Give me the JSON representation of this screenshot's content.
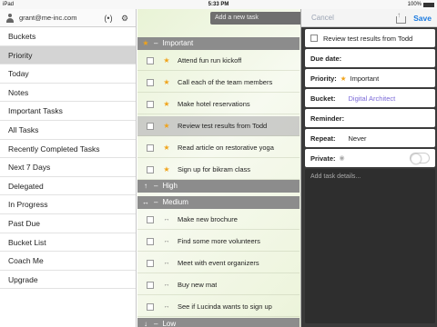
{
  "status_bar": {
    "carrier": "iPad",
    "time": "5:33 PM",
    "battery": "100%"
  },
  "sidebar": {
    "account_email": "grant@me-inc.com",
    "sync_icon": "(•)",
    "settings_icon": "⚙",
    "items": [
      {
        "label": "Buckets",
        "selected": false
      },
      {
        "label": "Priority",
        "selected": true
      },
      {
        "label": "Today",
        "selected": false
      },
      {
        "label": "Notes",
        "selected": false
      },
      {
        "label": "Important Tasks",
        "selected": false
      },
      {
        "label": "All Tasks",
        "selected": false
      },
      {
        "label": "Recently Completed Tasks",
        "selected": false
      },
      {
        "label": "Next 7 Days",
        "selected": false
      },
      {
        "label": "Delegated",
        "selected": false
      },
      {
        "label": "In Progress",
        "selected": false
      },
      {
        "label": "Past Due",
        "selected": false
      },
      {
        "label": "Bucket List",
        "selected": false
      },
      {
        "label": "Coach Me",
        "selected": false
      },
      {
        "label": "Upgrade",
        "selected": false
      }
    ]
  },
  "main": {
    "new_task_placeholder": "Add a new task",
    "groups": {
      "important": {
        "icon": "★",
        "collapse": "–",
        "label": "Important"
      },
      "high": {
        "icon": "↑",
        "collapse": "–",
        "label": "High"
      },
      "medium": {
        "icon": "↔",
        "collapse": "–",
        "label": "Medium"
      },
      "low": {
        "icon": "↓",
        "collapse": "–",
        "label": "Low"
      }
    },
    "important_tasks": [
      {
        "title": "Attend fun run kickoff",
        "prio_icon": "★"
      },
      {
        "title": "Call each of the team members",
        "prio_icon": "★"
      },
      {
        "title": "Make hotel reservations",
        "prio_icon": "★"
      },
      {
        "title": "Review test results from Todd",
        "prio_icon": "★"
      },
      {
        "title": "Read article on restorative yoga",
        "prio_icon": "★"
      },
      {
        "title": "Sign up for bikram class",
        "prio_icon": "★"
      }
    ],
    "medium_tasks": [
      {
        "title": "Make new brochure",
        "prio_icon": "↔"
      },
      {
        "title": "Find some more volunteers",
        "prio_icon": "↔"
      },
      {
        "title": "Meet with event organizers",
        "prio_icon": "↔"
      },
      {
        "title": "Buy new mat",
        "prio_icon": "↔"
      },
      {
        "title": "See if Lucinda wants to sign up",
        "prio_icon": "↔"
      }
    ]
  },
  "detail": {
    "cancel_label": "Cancel",
    "save_label": "Save",
    "task_title": "Review test results from Todd",
    "due_date_label": "Due date:",
    "due_date_value": "",
    "priority_label": "Priority:",
    "priority_value": "Important",
    "bucket_label": "Bucket:",
    "bucket_value": "Digital Architect",
    "reminder_label": "Reminder:",
    "reminder_value": "",
    "repeat_label": "Repeat:",
    "repeat_value": "Never",
    "private_label": "Private:",
    "private_on": false,
    "details_placeholder": "Add task details..."
  },
  "colors": {
    "accent_blue": "#1a7ae0",
    "star_orange": "#f0a31a",
    "bucket_link": "#7b6ad8",
    "group_header": "#8c8c8c"
  }
}
